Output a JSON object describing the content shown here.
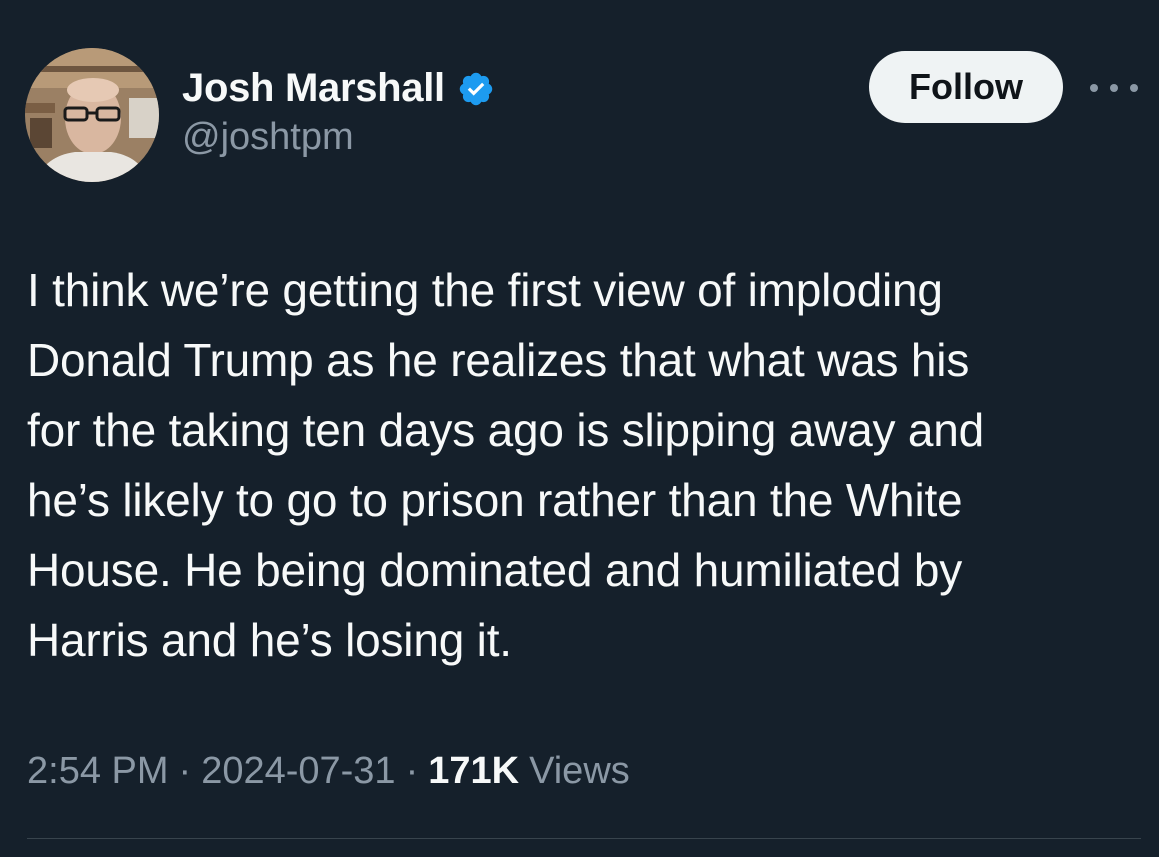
{
  "author": {
    "display_name": "Josh Marshall",
    "handle": "@joshtpm",
    "verified": true,
    "avatar_icon": "profile-photo"
  },
  "actions": {
    "follow_label": "Follow",
    "more_icon": "more-horizontal-icon"
  },
  "tweet": {
    "lines": [
      "I think we’re getting the first view of imploding",
      "Donald Trump as he realizes that what was his",
      "for the taking ten days ago is slipping away and",
      "he’s likely to go to prison rather than the White",
      "House. He being dominated and humiliated by",
      "Harris and he’s losing it."
    ]
  },
  "meta": {
    "time": "2:54 PM",
    "separator": "·",
    "date": "2024-07-31",
    "views_count": "171K",
    "views_label": "Views"
  },
  "colors": {
    "background": "#15202b",
    "primary_text": "#f7f9f9",
    "secondary_text": "#8b98a5",
    "verified_blue": "#1d9bf0",
    "follow_bg": "#eff3f4"
  }
}
